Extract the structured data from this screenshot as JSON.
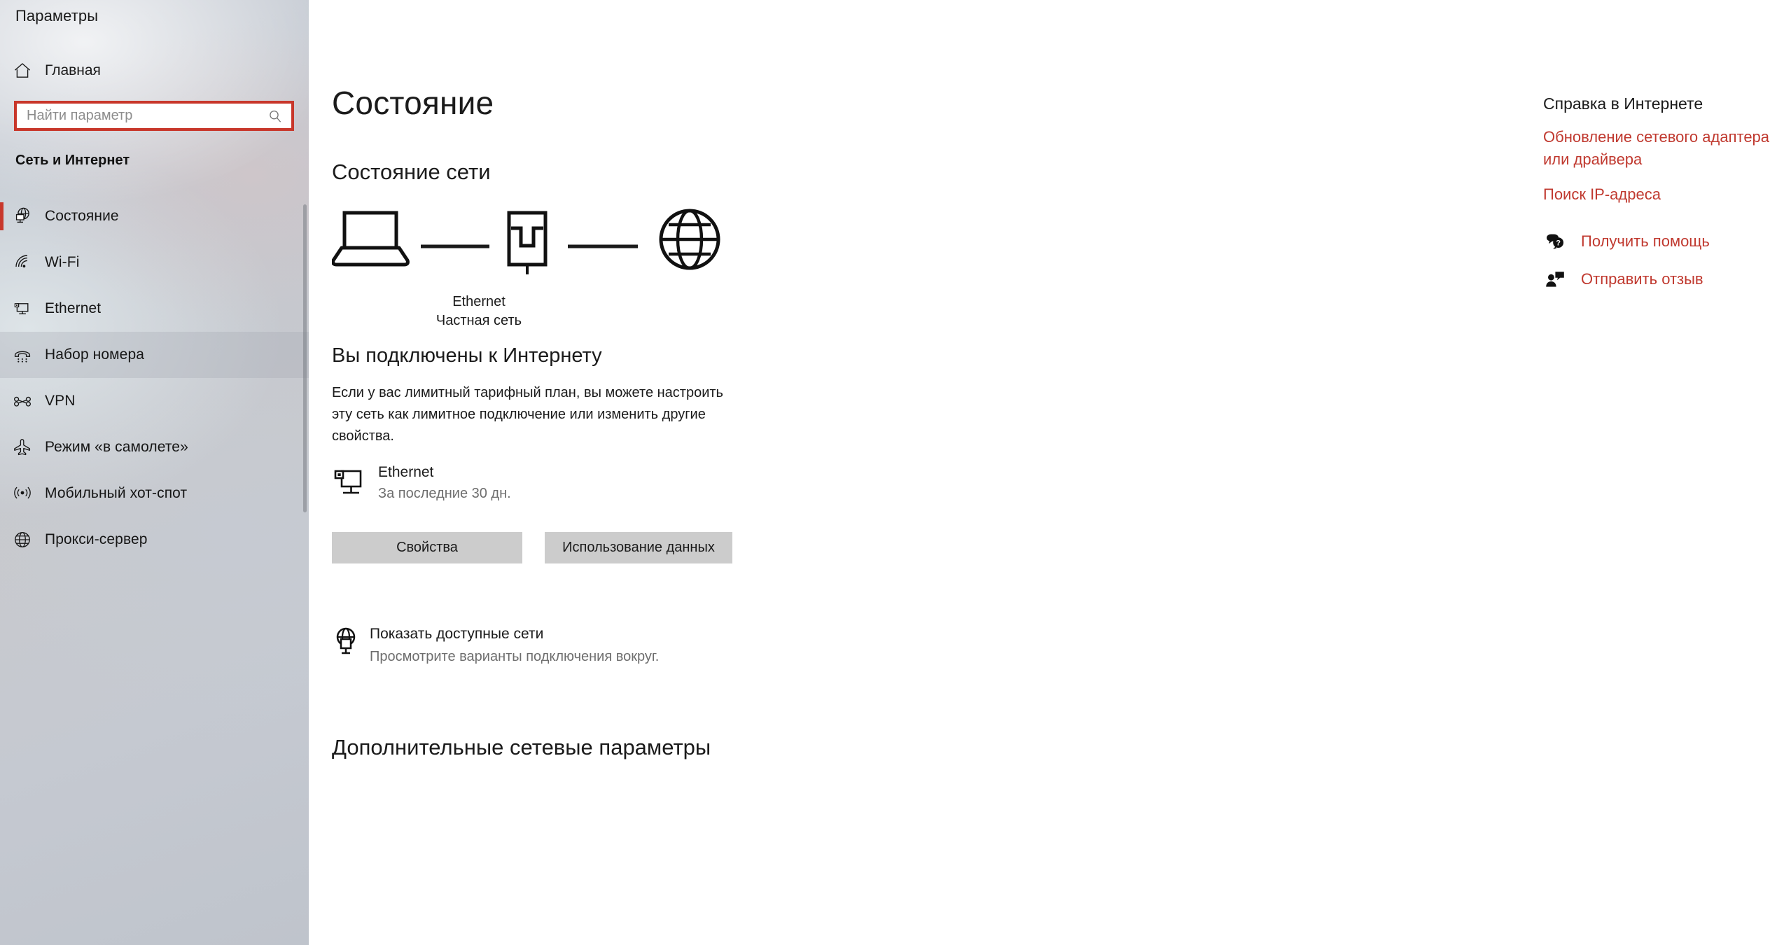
{
  "window": {
    "app_title": "Параметры",
    "controls": [
      {
        "name": "minimize",
        "glyph": "minimize-icon"
      },
      {
        "name": "restore",
        "glyph": "restore-icon"
      },
      {
        "name": "close",
        "glyph": "close-icon"
      }
    ]
  },
  "colors": {
    "accent_red": "#c8372b",
    "link_red": "#c0392f",
    "button_grey": "#cccccc",
    "text_primary": "#1b1b1b",
    "text_secondary": "#6e6e6e"
  },
  "sidebar": {
    "home_label": "Главная",
    "home_icon": "home-icon",
    "search": {
      "placeholder": "Найти параметр",
      "value": "",
      "icon": "search-icon",
      "highlighted": true
    },
    "group_title": "Сеть и Интернет",
    "items": [
      {
        "label": "Состояние",
        "icon": "network-status-icon",
        "selected": true,
        "hovered": false
      },
      {
        "label": "Wi-Fi",
        "icon": "wifi-icon",
        "selected": false,
        "hovered": false
      },
      {
        "label": "Ethernet",
        "icon": "ethernet-icon",
        "selected": false,
        "hovered": false
      },
      {
        "label": "Набор номера",
        "icon": "dialup-phone-icon",
        "selected": false,
        "hovered": true
      },
      {
        "label": "VPN",
        "icon": "vpn-icon",
        "selected": false,
        "hovered": false
      },
      {
        "label": "Режим «в самолете»",
        "icon": "airplane-icon",
        "selected": false,
        "hovered": false
      },
      {
        "label": "Мобильный хот-спот",
        "icon": "hotspot-icon",
        "selected": false,
        "hovered": false
      },
      {
        "label": "Прокси-сервер",
        "icon": "proxy-globe-icon",
        "selected": false,
        "hovered": false
      }
    ]
  },
  "main": {
    "page_title": "Состояние",
    "section_title": "Состояние сети",
    "diagram": {
      "device_icon": "laptop-icon",
      "router_icon": "ethernet-port-icon",
      "internet_icon": "globe-icon",
      "label_line1": "Ethernet",
      "label_line2": "Частная сеть"
    },
    "connection": {
      "heading": "Вы подключены к Интернету",
      "description": "Если у вас лимитный тарифный план, вы можете настроить эту сеть как лимитное подключение или изменить другие свойства."
    },
    "adapter": {
      "icon": "ethernet-monitor-icon",
      "name": "Ethernet",
      "subtitle": "За последние 30 дн."
    },
    "buttons": {
      "properties": "Свойства",
      "data_usage": "Использование данных"
    },
    "show_networks": {
      "icon": "globe-small-icon",
      "title": "Показать доступные сети",
      "subtitle": "Просмотрите варианты подключения вокруг."
    },
    "advanced_heading": "Дополнительные сетевые параметры"
  },
  "help": {
    "title": "Справка в Интернете",
    "links": [
      "Обновление сетевого адаптера или драйвера",
      "Поиск IP-адреса"
    ],
    "actions": [
      {
        "label": "Получить помощь",
        "icon": "question-bubble-icon"
      },
      {
        "label": "Отправить отзыв",
        "icon": "feedback-person-icon"
      }
    ]
  }
}
